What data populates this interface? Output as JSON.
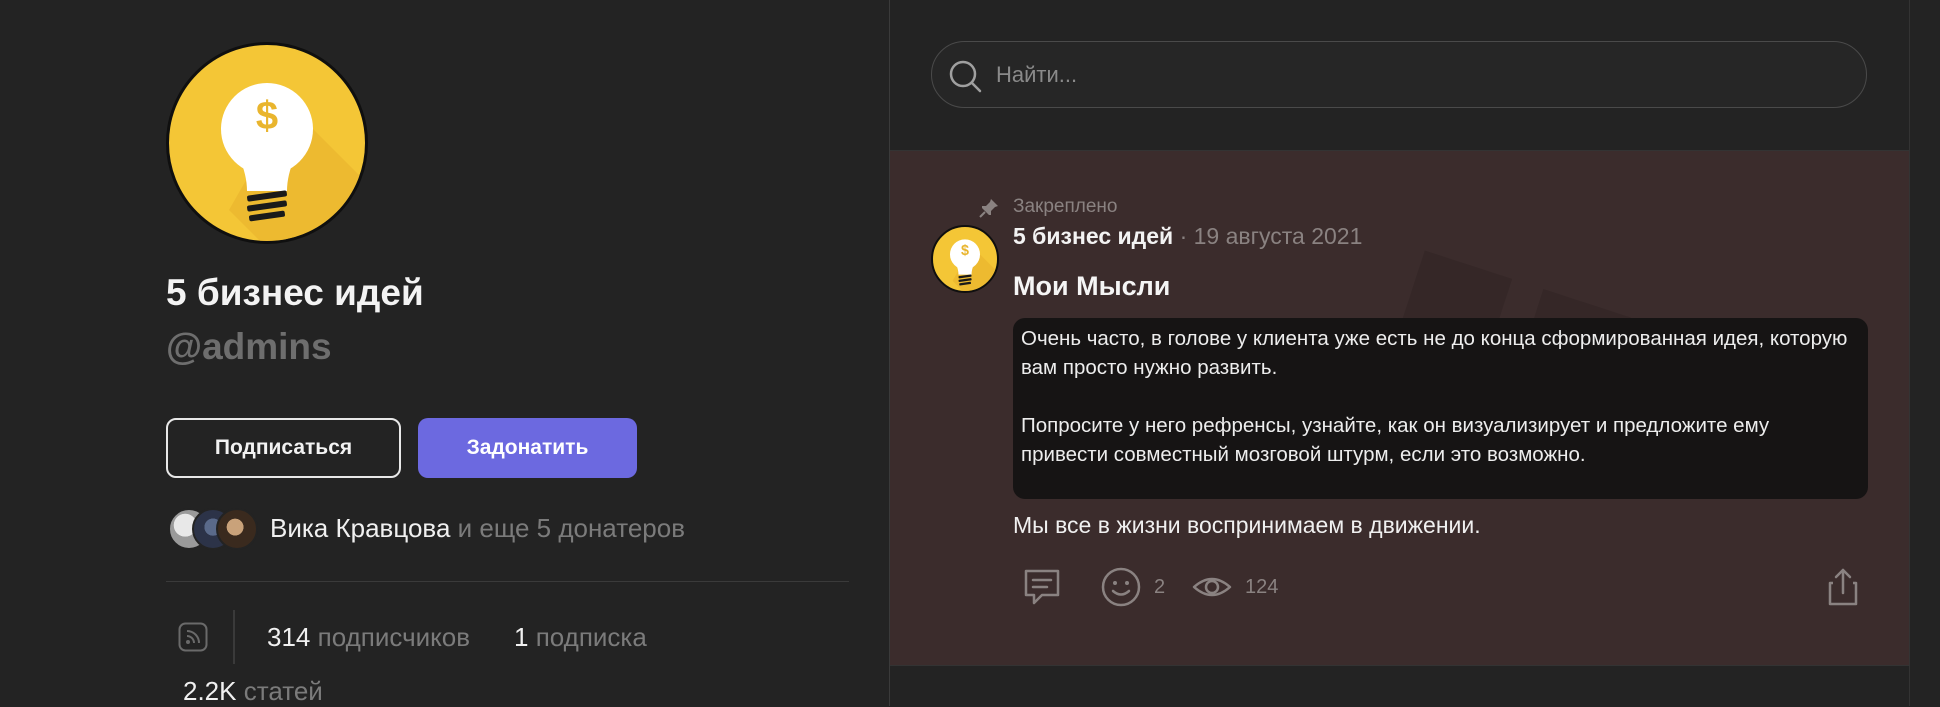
{
  "profile": {
    "name": "5 бизнес идей",
    "handle": "@admins",
    "subscribe_label": "Подписаться",
    "donate_label": "Задонатить",
    "donors": {
      "name": "Вика Кравцова",
      "rest": " и еще 5 донатеров"
    },
    "stats": {
      "subscribers_count": "314",
      "subscribers_label": " подписчиков",
      "subscriptions_count": "1",
      "subscriptions_label": " подписка",
      "articles_count": "2.2K",
      "articles_label": " статей"
    },
    "avatar_icon": "lightbulb-dollar-icon",
    "avatar_glyph": "$"
  },
  "search": {
    "placeholder": "Найти..."
  },
  "post": {
    "pinned_label": "Закреплено",
    "author": "5 бизнес идей",
    "date": " · 19 августа 2021",
    "title": "Мои Мысли",
    "quote_p1": "Очень часто, в голове у клиента уже есть не до конца сформированная идея, которую вам просто нужно развить.",
    "quote_p2": "Попросите у него рефренсы, узнайте, как он визуализирует и предложите ему привести совместный мозговой штурм, если это возможно.",
    "body": "Мы все в жизни воспринимаем в движении.",
    "reactions_count": "2",
    "views_count": "124"
  },
  "colors": {
    "background": "#232323",
    "post_background": "#3b2c2c",
    "accent": "#6c69e0",
    "avatar_yellow": "#f4c636"
  }
}
